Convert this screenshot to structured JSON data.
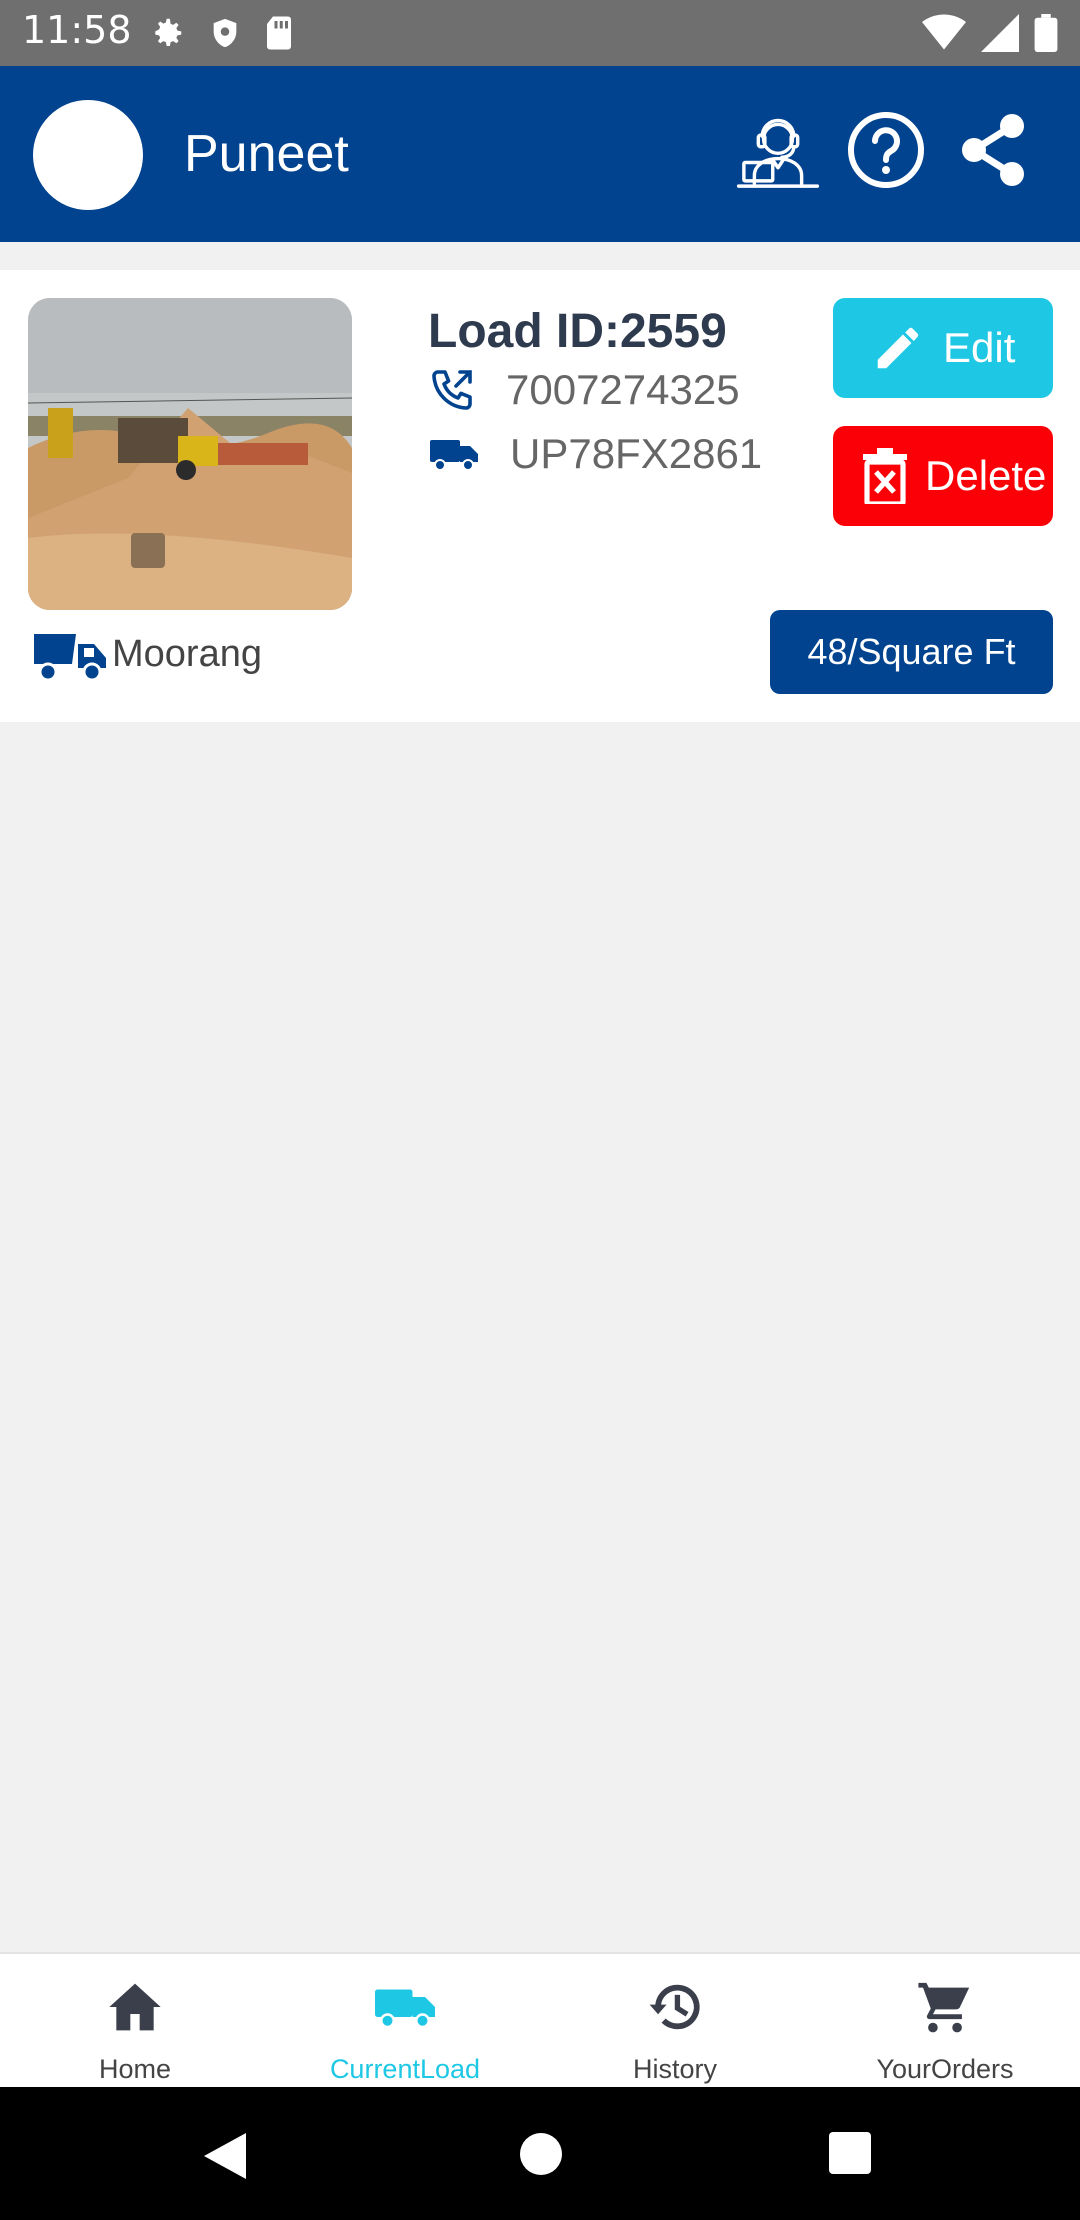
{
  "status_bar": {
    "time": "11:58",
    "left_icons": [
      "settings-icon",
      "shield-icon",
      "sd-card-icon"
    ],
    "right_icons": [
      "wifi-icon",
      "signal-icon",
      "battery-icon"
    ]
  },
  "header": {
    "user_name": "Puneet",
    "actions": [
      "support-agent-icon",
      "help-icon",
      "share-icon"
    ],
    "color": "#01438f"
  },
  "load_card": {
    "load_id": "Load ID:2559",
    "phone": "7007274325",
    "vehicle_number": "UP78FX2861",
    "material": "Moorang",
    "rate": "48/Square Ft",
    "edit_label": "Edit",
    "delete_label": "Delete",
    "edit_color": "#1ec8e5",
    "delete_color": "#fb0006"
  },
  "bottom_nav": {
    "items": [
      {
        "label": "Home",
        "icon": "home-icon"
      },
      {
        "label": "CurrentLoad",
        "icon": "truck-icon",
        "active": true
      },
      {
        "label": "History",
        "icon": "history-icon"
      },
      {
        "label": "YourOrders",
        "icon": "cart-icon"
      }
    ],
    "active_color": "#1ec8e5"
  },
  "system_nav": [
    "back-icon",
    "home-circle-icon",
    "recents-icon"
  ]
}
